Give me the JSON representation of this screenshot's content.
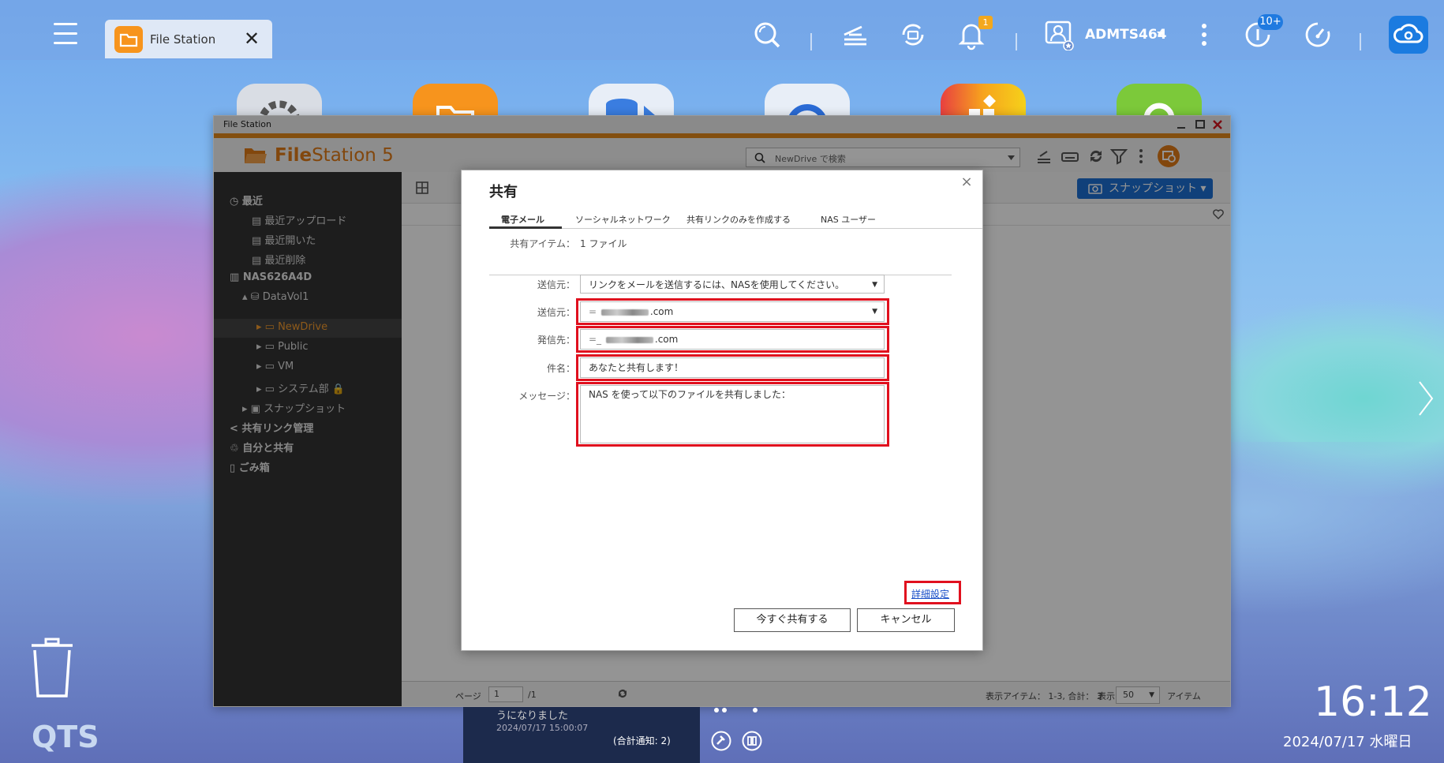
{
  "taskbar": {
    "tab_title": "File Station",
    "tab_close": "✕",
    "notification_count": "1",
    "user_name": "ADMTS464",
    "update_count": "10+"
  },
  "window": {
    "title": "File Station",
    "logo_bold": "File",
    "logo_rest": "Station 5",
    "search_placeholder": "NewDrive で検索",
    "snapshot_button": "スナップショット"
  },
  "sidebar": {
    "recent": "最近",
    "recent_upload": "最近アップロード",
    "recent_open": "最近開いた",
    "recent_delete": "最近削除",
    "nas": "NAS626A4D",
    "datavol": "DataVol1",
    "newdrive": "NewDrive",
    "public": "Public",
    "vm": "VM",
    "system": "システム部",
    "snapshot": "スナップショット",
    "share_link": "共有リンク管理",
    "shared_with_me": "自分と共有",
    "trash": "ごみ箱"
  },
  "status_bar": {
    "page_label": "ページ",
    "page_value": "1",
    "page_total": "/1",
    "items": "表示アイテム： 1-3, 合計： 3",
    "show_label": "表示",
    "show_value": "50",
    "items_label": "アイテム"
  },
  "dialog": {
    "title": "共有",
    "close": "×",
    "tabs": [
      "電子メール",
      "ソーシャルネットワーク",
      "共有リンクのみを作成する",
      "NAS ユーザー"
    ],
    "shared_items_label": "共有アイテム：",
    "shared_items_value": "1 ファイル",
    "from_method_label": "送信元：",
    "from_method_value": "リンクをメールを送信するには、NASを使用してください。",
    "from_label": "送信元：",
    "from_value_suffix": ".com",
    "to_label": "発信先：",
    "to_value_suffix": ".com",
    "subject_label": "件名：",
    "subject_value": "あなたと共有します！",
    "message_label": "メッセージ：",
    "message_value": "NAS を使って以下のファイルを共有しました：",
    "advanced_link": "詳細設定",
    "share_now": "今すぐ共有する",
    "cancel": "キャンセル"
  },
  "notification": {
    "text": "うになりました",
    "time": "2024/07/17 15:00:07",
    "summary": "(合計通知: 2)"
  },
  "desktop": {
    "qts_label": "QTS",
    "clock": "16:12",
    "date": "2024/07/17 水曜日"
  },
  "colors": {
    "accent_orange": "#e2891b",
    "highlight_red": "#e0101e",
    "snapshot_blue": "#1c6fd3"
  }
}
